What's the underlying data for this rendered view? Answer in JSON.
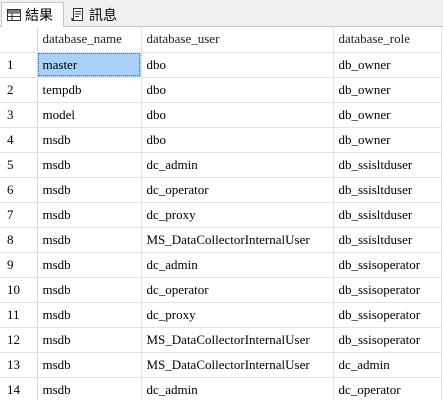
{
  "tabs": [
    {
      "label": "結果",
      "icon": "grid-icon"
    },
    {
      "label": "訊息",
      "icon": "message-icon"
    }
  ],
  "grid": {
    "columns": [
      "database_name",
      "database_user",
      "database_role"
    ],
    "rows": [
      {
        "n": "1",
        "database_name": "master",
        "database_user": "dbo",
        "database_role": "db_owner"
      },
      {
        "n": "2",
        "database_name": "tempdb",
        "database_user": "dbo",
        "database_role": "db_owner"
      },
      {
        "n": "3",
        "database_name": "model",
        "database_user": "dbo",
        "database_role": "db_owner"
      },
      {
        "n": "4",
        "database_name": "msdb",
        "database_user": "dbo",
        "database_role": "db_owner"
      },
      {
        "n": "5",
        "database_name": "msdb",
        "database_user": "dc_admin",
        "database_role": "db_ssisltduser"
      },
      {
        "n": "6",
        "database_name": "msdb",
        "database_user": "dc_operator",
        "database_role": "db_ssisltduser"
      },
      {
        "n": "7",
        "database_name": "msdb",
        "database_user": "dc_proxy",
        "database_role": "db_ssisltduser"
      },
      {
        "n": "8",
        "database_name": "msdb",
        "database_user": "MS_DataCollectorInternalUser",
        "database_role": "db_ssisltduser"
      },
      {
        "n": "9",
        "database_name": "msdb",
        "database_user": "dc_admin",
        "database_role": "db_ssisoperator"
      },
      {
        "n": "10",
        "database_name": "msdb",
        "database_user": "dc_operator",
        "database_role": "db_ssisoperator"
      },
      {
        "n": "11",
        "database_name": "msdb",
        "database_user": "dc_proxy",
        "database_role": "db_ssisoperator"
      },
      {
        "n": "12",
        "database_name": "msdb",
        "database_user": "MS_DataCollectorInternalUser",
        "database_role": "db_ssisoperator"
      },
      {
        "n": "13",
        "database_name": "msdb",
        "database_user": "MS_DataCollectorInternalUser",
        "database_role": "dc_admin"
      },
      {
        "n": "14",
        "database_name": "msdb",
        "database_user": "dc_admin",
        "database_role": "dc_operator"
      }
    ]
  },
  "colors": {
    "selection": "#a8d0f8",
    "tab_bar": "#f0f0f0",
    "grid_line": "#e3e3e3"
  }
}
